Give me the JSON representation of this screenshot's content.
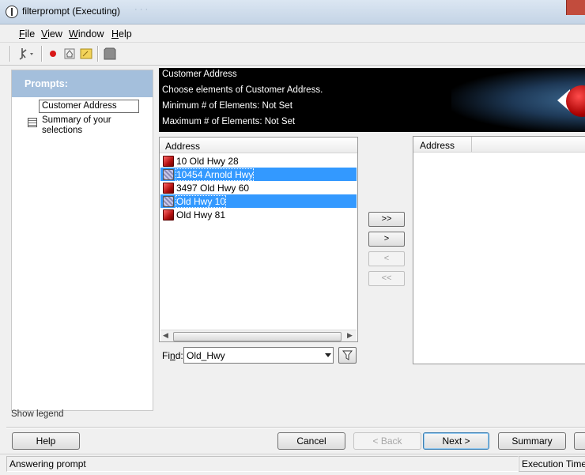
{
  "window": {
    "title": "filterprompt (Executing)"
  },
  "menu": [
    {
      "label": "File",
      "accel": "F",
      "rest": "ile"
    },
    {
      "label": "View",
      "accel": "V",
      "rest": "iew"
    },
    {
      "label": "Window",
      "accel": "W",
      "rest": "indow"
    },
    {
      "label": "Help",
      "accel": "H",
      "rest": "elp"
    }
  ],
  "toolbar": {
    "icons": [
      "pointer-icon",
      "record-icon",
      "home-icon",
      "note-icon",
      "stop-icon"
    ]
  },
  "sidebar": {
    "header": "Prompts:",
    "items": [
      {
        "label": "Customer Address",
        "selected": true
      },
      {
        "label": "Summary of your selections",
        "selected": false
      }
    ],
    "show_legend": "Show legend"
  },
  "banner": {
    "title": "Customer Address",
    "instruction": "Choose elements of Customer Address.",
    "minimum": "Minimum # of Elements: Not Set",
    "maximum": "Maximum # of Elements: Not Set"
  },
  "available": {
    "header": "Address",
    "rows": [
      {
        "text": "10 Old Hwy 28",
        "selected": false,
        "icon": "red-cube-icon"
      },
      {
        "text": "10454 Arnold Hwy",
        "selected": true,
        "icon": "grey-cube-icon"
      },
      {
        "text": "3497 Old Hwy 60",
        "selected": false,
        "icon": "red-cube-icon"
      },
      {
        "text": "Old Hwy 10",
        "selected": true,
        "icon": "grey-cube-icon"
      },
      {
        "text": "Old Hwy 81",
        "selected": false,
        "icon": "red-cube-icon"
      }
    ]
  },
  "find": {
    "label": "Find:",
    "accel": "n",
    "value": "Old_Hwy"
  },
  "move_buttons": [
    {
      "label": ">>",
      "enabled": true
    },
    {
      "label": ">",
      "enabled": true
    },
    {
      "label": "<",
      "enabled": false
    },
    {
      "label": "<<",
      "enabled": false
    }
  ],
  "selected": {
    "header": "Address",
    "rows": []
  },
  "buttons": {
    "help": "Help",
    "cancel": "Cancel",
    "back": "< Back",
    "next": "Next >",
    "summary": "Summary"
  },
  "status": {
    "left": "Answering prompt",
    "right": "Execution Time"
  },
  "colors": {
    "selection": "#3399ff",
    "prompt_header": "#a4bfdc",
    "banner": "#000000"
  }
}
